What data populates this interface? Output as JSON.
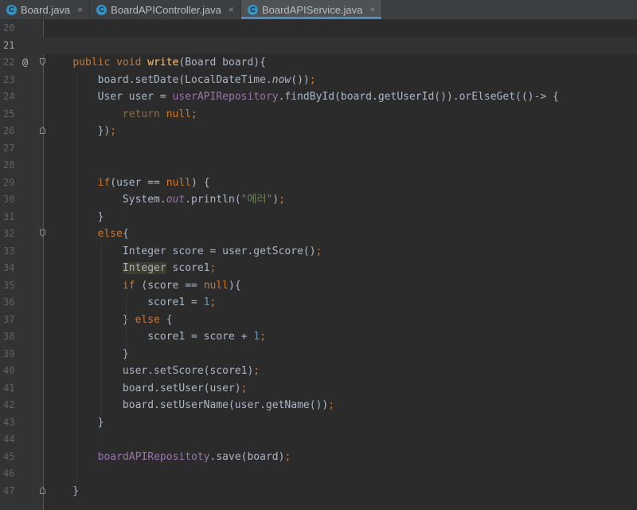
{
  "tabs": [
    {
      "label": "Board.java",
      "active": false
    },
    {
      "label": "BoardAPIController.java",
      "active": false
    },
    {
      "label": "BoardAPIService.java",
      "active": true
    }
  ],
  "tab_icon_letter": "C",
  "close_glyph": "×",
  "current_line": 21,
  "override_marker": "@",
  "lines": [
    {
      "n": 20,
      "tokens": []
    },
    {
      "n": 21,
      "tokens": []
    },
    {
      "n": 22,
      "tokens": [
        [
          "",
          "    "
        ],
        [
          "kw",
          "public "
        ],
        [
          "kw",
          "void "
        ],
        [
          "fn",
          "write"
        ],
        [
          "",
          "(Board board){"
        ]
      ]
    },
    {
      "n": 23,
      "tokens": [
        [
          "",
          "        board.setDate(LocalDateTime."
        ],
        [
          "ital",
          "now"
        ],
        [
          "",
          "())"
        ],
        [
          "kw",
          ";"
        ]
      ]
    },
    {
      "n": 24,
      "tokens": [
        [
          "",
          "        User user = "
        ],
        [
          "fld",
          "userAPIRepository"
        ],
        [
          "",
          ".findById(board.getUserId()).orElseGet(()-> {"
        ]
      ]
    },
    {
      "n": 25,
      "tokens": [
        [
          "",
          "            "
        ],
        [
          "dim",
          "return "
        ],
        [
          "kw",
          "null;"
        ]
      ]
    },
    {
      "n": 26,
      "tokens": [
        [
          "",
          "        })"
        ],
        [
          "kw",
          ";"
        ]
      ]
    },
    {
      "n": 27,
      "tokens": []
    },
    {
      "n": 28,
      "tokens": []
    },
    {
      "n": 29,
      "tokens": [
        [
          "",
          "        "
        ],
        [
          "kw",
          "if"
        ],
        [
          "",
          "(user == "
        ],
        [
          "kw",
          "null"
        ],
        [
          "",
          ") {"
        ]
      ]
    },
    {
      "n": 30,
      "tokens": [
        [
          "",
          "            System."
        ],
        [
          "st",
          "out"
        ],
        [
          "",
          ".println("
        ],
        [
          "str",
          "\"에러\""
        ],
        [
          "",
          ")"
        ],
        [
          "kw",
          ";"
        ]
      ]
    },
    {
      "n": 31,
      "tokens": [
        [
          "",
          "        }"
        ]
      ]
    },
    {
      "n": 32,
      "tokens": [
        [
          "",
          "        "
        ],
        [
          "kw",
          "else"
        ],
        [
          "",
          "{"
        ]
      ]
    },
    {
      "n": 33,
      "tokens": [
        [
          "",
          "            Integer score = user.getScore()"
        ],
        [
          "kw",
          ";"
        ]
      ]
    },
    {
      "n": 34,
      "tokens": [
        [
          "",
          "            "
        ],
        [
          "hl",
          "Integer"
        ],
        [
          "",
          " score1"
        ],
        [
          "kw",
          ";"
        ]
      ]
    },
    {
      "n": 35,
      "tokens": [
        [
          "",
          "            "
        ],
        [
          "kw",
          "if "
        ],
        [
          "",
          "(score == "
        ],
        [
          "kw",
          "null"
        ],
        [
          "",
          "){"
        ]
      ]
    },
    {
      "n": 36,
      "tokens": [
        [
          "",
          "                score1 = "
        ],
        [
          "num",
          "1"
        ],
        [
          "kw",
          ";"
        ]
      ]
    },
    {
      "n": 37,
      "tokens": [
        [
          "",
          "            } "
        ],
        [
          "kw",
          "else "
        ],
        [
          "",
          "{"
        ]
      ]
    },
    {
      "n": 38,
      "tokens": [
        [
          "",
          "                score1 = score + "
        ],
        [
          "num",
          "1"
        ],
        [
          "kw",
          ";"
        ]
      ]
    },
    {
      "n": 39,
      "tokens": [
        [
          "",
          "            }"
        ]
      ]
    },
    {
      "n": 40,
      "tokens": [
        [
          "",
          "            user.setScore(score1)"
        ],
        [
          "kw",
          ";"
        ]
      ]
    },
    {
      "n": 41,
      "tokens": [
        [
          "",
          "            board.setUser(user)"
        ],
        [
          "kw",
          ";"
        ]
      ]
    },
    {
      "n": 42,
      "tokens": [
        [
          "",
          "            board.setUserName(user.getName())"
        ],
        [
          "kw",
          ";"
        ]
      ]
    },
    {
      "n": 43,
      "tokens": [
        [
          "",
          "        }"
        ]
      ]
    },
    {
      "n": 44,
      "tokens": []
    },
    {
      "n": 45,
      "tokens": [
        [
          "",
          "        "
        ],
        [
          "fld",
          "boardAPIRepositoty"
        ],
        [
          "",
          ".save(board)"
        ],
        [
          "kw",
          ";"
        ]
      ]
    },
    {
      "n": 46,
      "tokens": []
    },
    {
      "n": 47,
      "tokens": [
        [
          "",
          "    }"
        ]
      ]
    }
  ]
}
